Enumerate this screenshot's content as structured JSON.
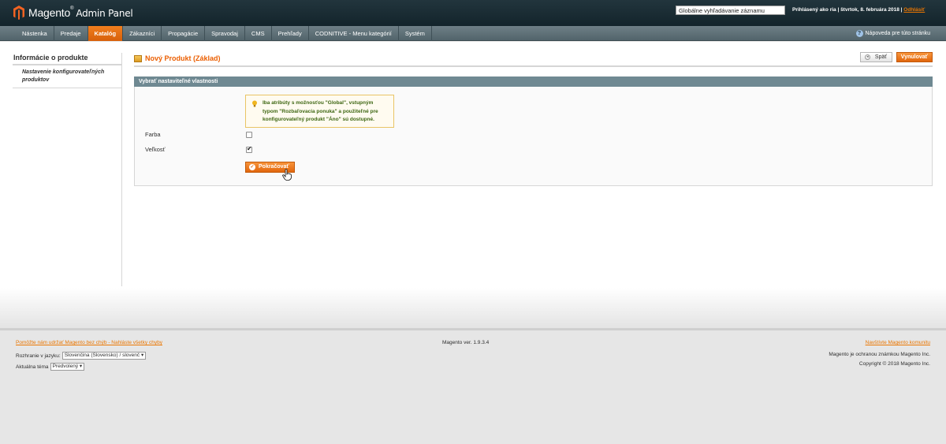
{
  "header": {
    "logo_brand": "Magento",
    "logo_tm": "®",
    "logo_panel": "Admin Panel",
    "search_placeholder": "Globálne vyhľadávanie záznamu",
    "user_info": "Prihlásený ako ria  |  štvrtok, 8. februára 2018  |  ",
    "logout": "Odhlásiť"
  },
  "nav": {
    "items": [
      {
        "label": "Nástenka"
      },
      {
        "label": "Predaje"
      },
      {
        "label": "Katalóg"
      },
      {
        "label": "Zákazníci"
      },
      {
        "label": "Propagácie"
      },
      {
        "label": "Spravodaj"
      },
      {
        "label": "CMS"
      },
      {
        "label": "Prehľady"
      },
      {
        "label": "CODNITIVE - Menu kategórií"
      },
      {
        "label": "Systém"
      }
    ],
    "help": "Nápoveda pre túto stránku"
  },
  "sidebar": {
    "title": "Informácie o produkte",
    "item": "Nastavenie konfigurovateľných produktov"
  },
  "content": {
    "title": "Nový Produkt (Základ)",
    "back_button": "Späť",
    "reset_button": "Vynulovať",
    "section_title": "Vybrať nastaviteľné vlastnosti",
    "notice": "Iba atribúty s možnosťou \"Global\", vstupným typom \"Rozbaľovacia ponuka\" a použiteľné pre konfigurovateľný produkt \"Áno\" sú dostupné.",
    "fields": [
      {
        "label": "Farba",
        "checked": false
      },
      {
        "label": "Veľkosť",
        "checked": true
      }
    ],
    "continue_button": "Pokračovať"
  },
  "footer": {
    "bug_link": "Pomôžte nám udržať Magento bez chýb - Nahláste všetky chyby",
    "version": "Magento ver. 1.9.3.4",
    "community_link": "Navštívte Magento komunitu",
    "trademark": "Magento je ochranou známkou Magento Inc.",
    "copyright": "Copyright © 2018 Magento Inc.",
    "language_label": "Rozhranie v jazyku:",
    "language_value": "Slovenčina (Slovensko) / slovenč",
    "theme_label": "Aktuálna téma",
    "theme_value": "Predvolený"
  },
  "colors": {
    "accent": "#eb5e00",
    "header_bg": "#1b2e36",
    "nav_bg": "#5f7178",
    "section_head": "#6f8992"
  }
}
